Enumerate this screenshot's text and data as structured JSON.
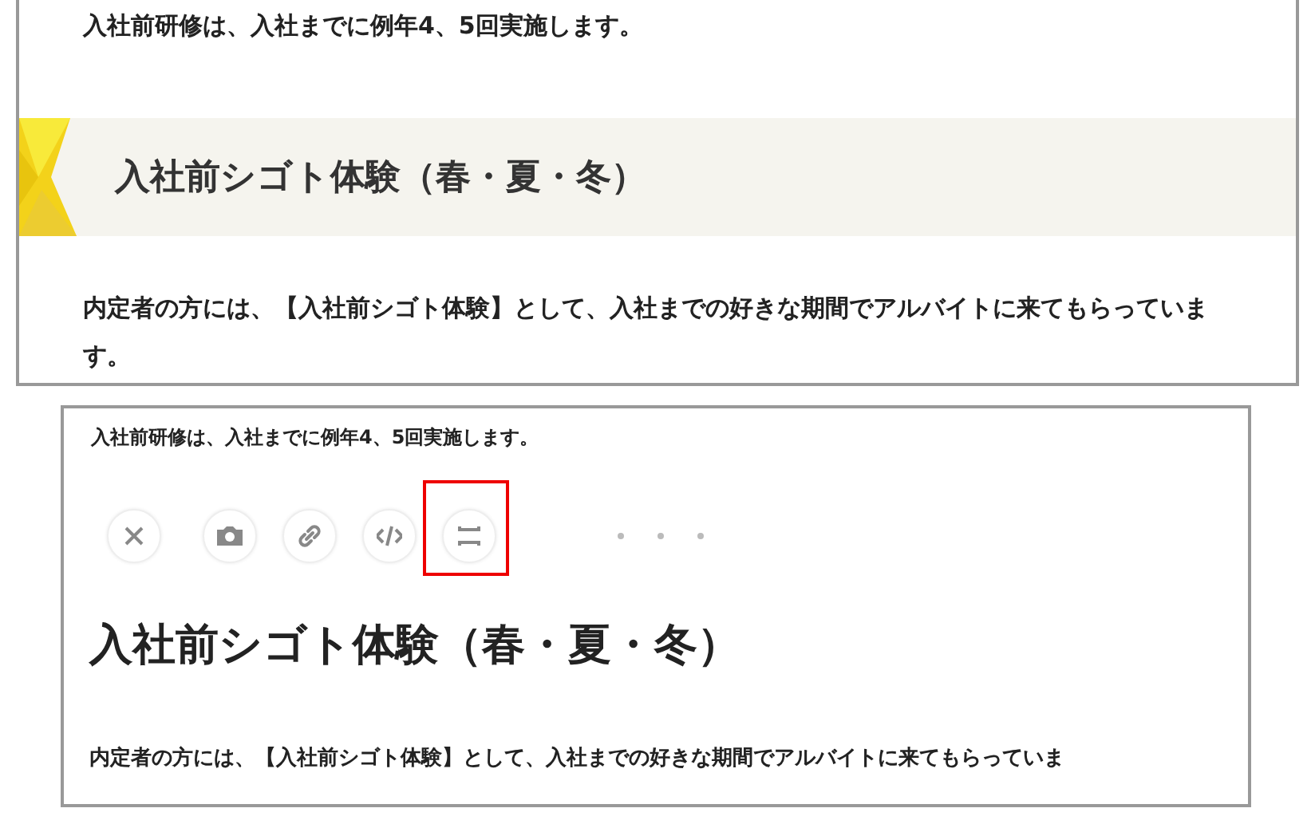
{
  "top_frame": {
    "intro": "入社前研修は、入社までに例年4、5回実施します。",
    "heading": "入社前シゴト体験（春・夏・冬）",
    "paragraph": "内定者の方には、【入社前シゴト体験】として、入社までの好きな期間でアルバイトに来てもらっています。"
  },
  "bottom_frame": {
    "intro": "入社前研修は、入社までに例年4、5回実施します。",
    "toolbar": [
      {
        "kind": "close",
        "highlighted": false
      },
      {
        "kind": "camera",
        "highlighted": false
      },
      {
        "kind": "link",
        "highlighted": false
      },
      {
        "kind": "code",
        "highlighted": false
      },
      {
        "kind": "divider",
        "highlighted": true
      },
      {
        "kind": "more",
        "highlighted": false
      }
    ],
    "heading": "入社前シゴト体験（春・夏・冬）",
    "paragraph": "内定者の方には、【入社前シゴト体験】として、入社までの好きな期間でアルバイトに来てもらっていま"
  }
}
